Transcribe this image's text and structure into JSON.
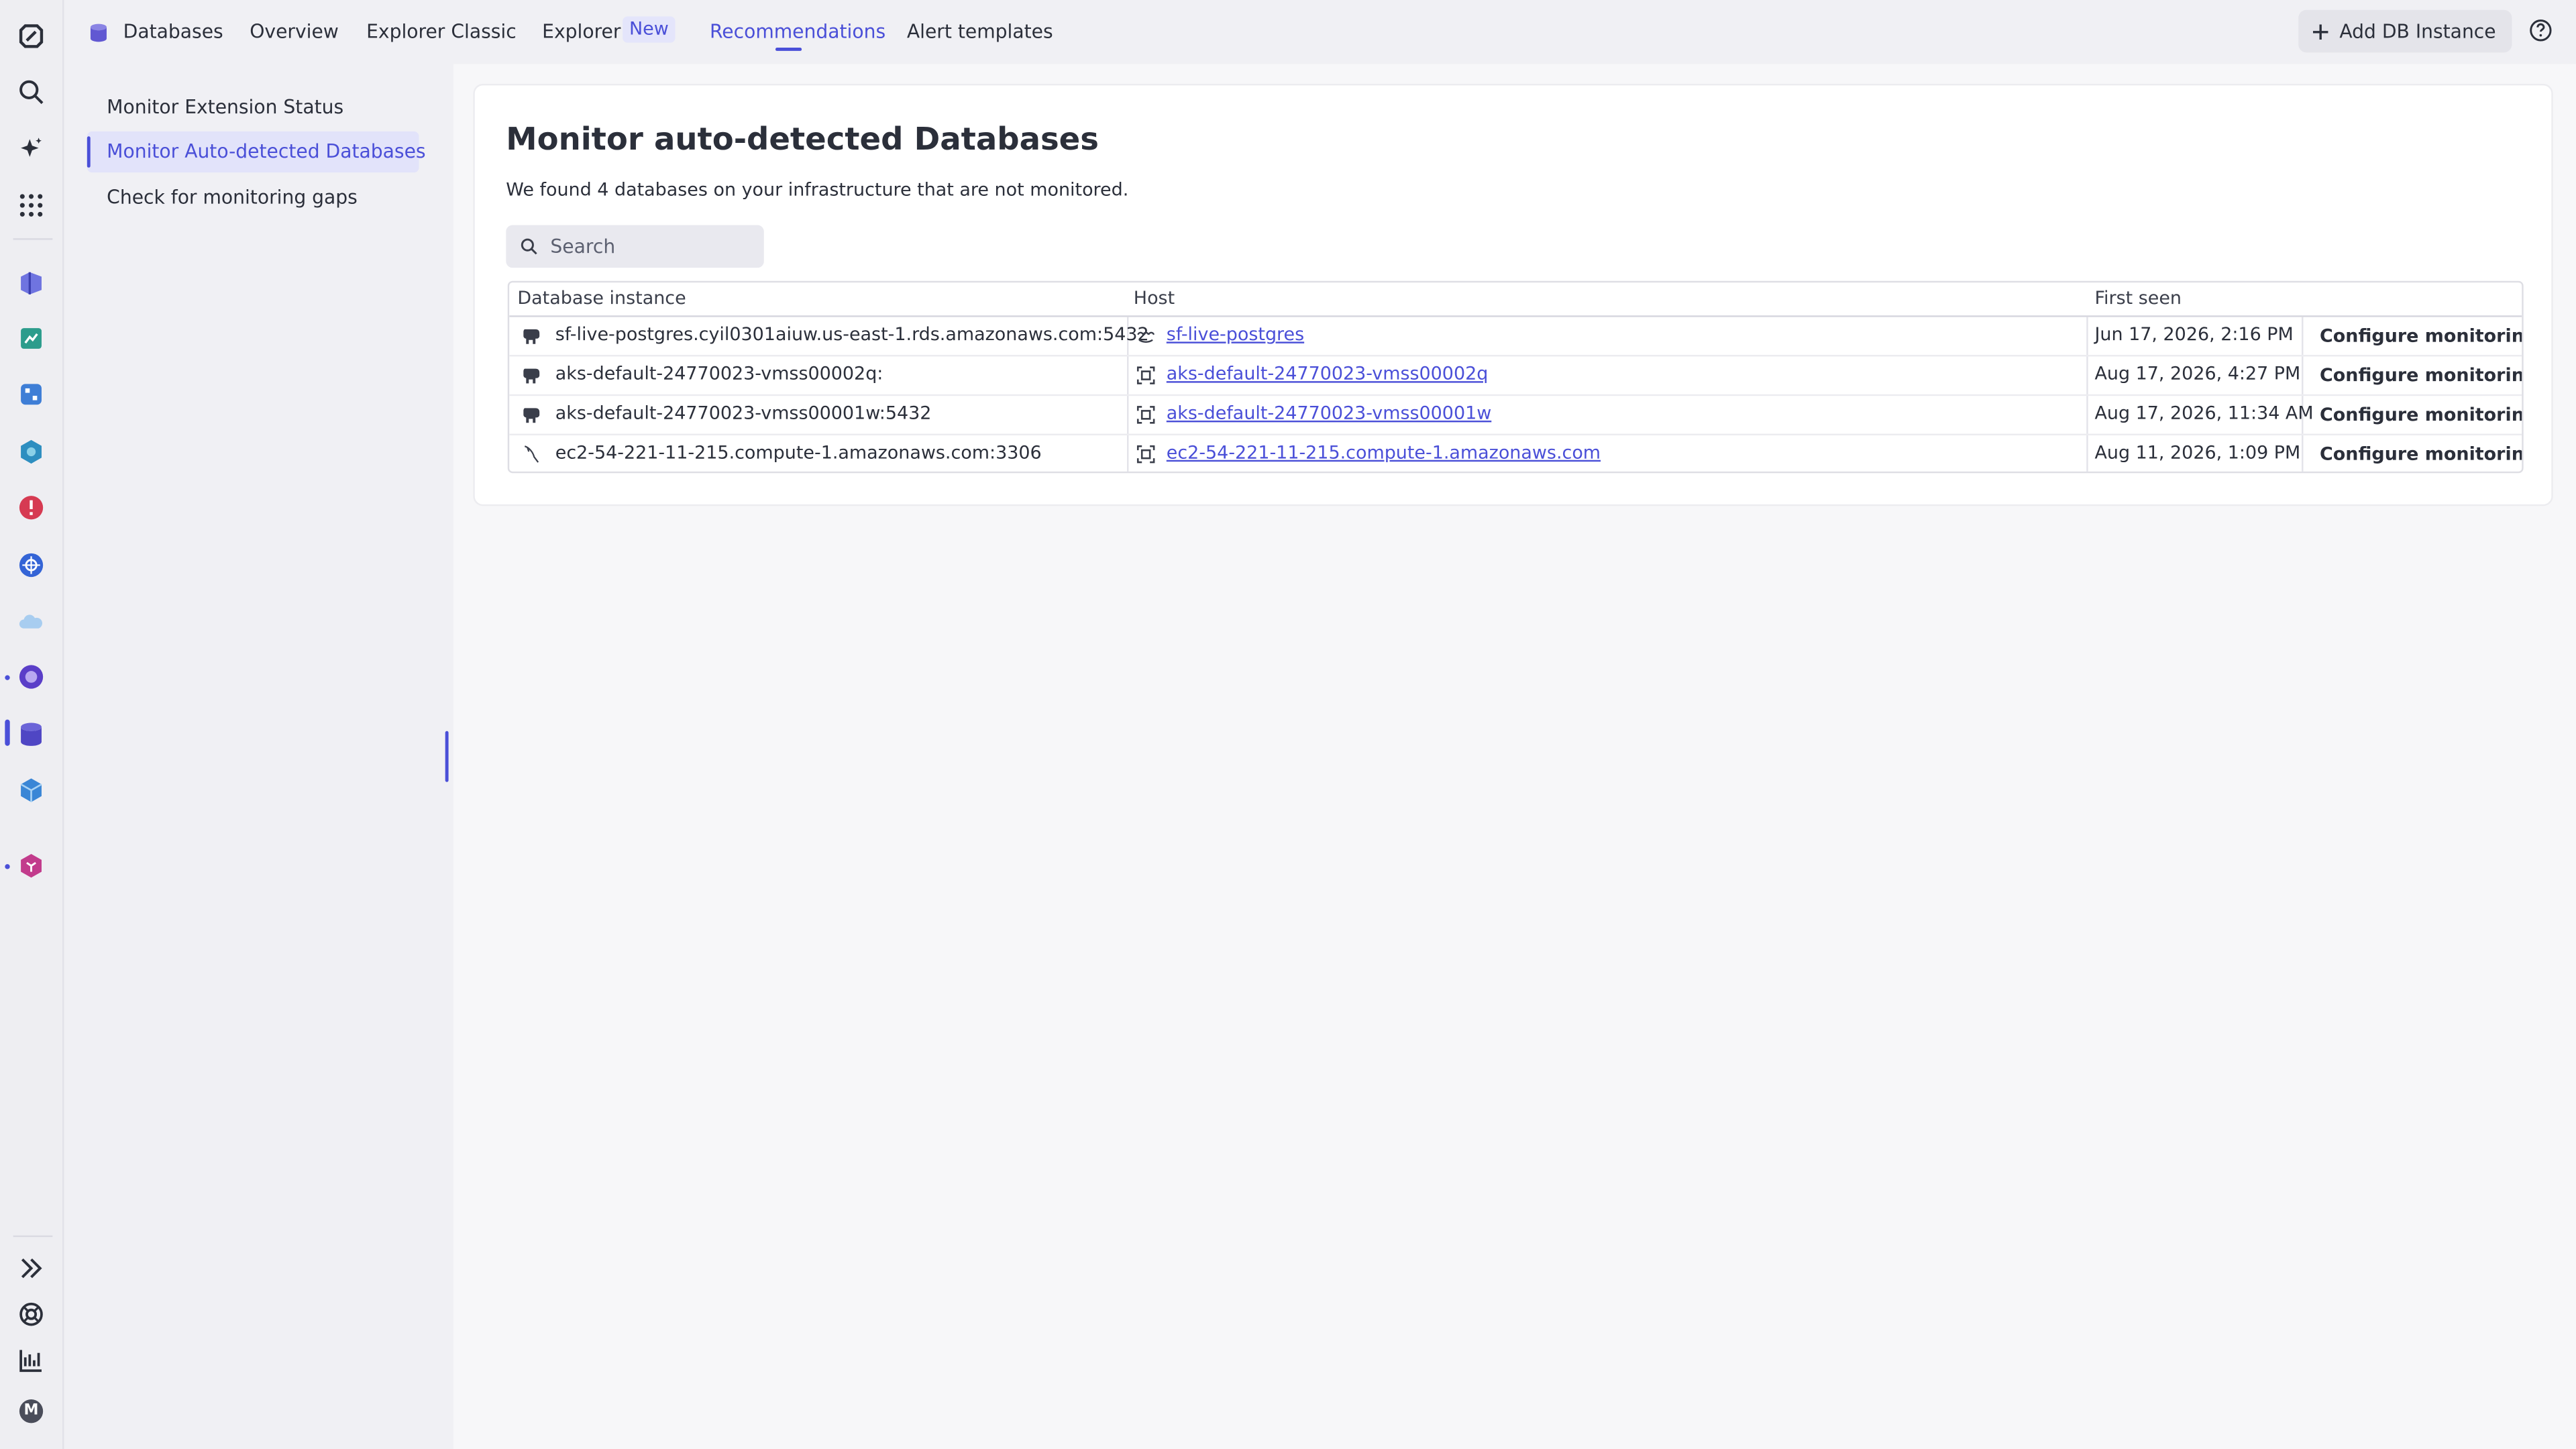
{
  "topbar": {
    "app_name": "Databases",
    "tabs": [
      {
        "label": "Overview"
      },
      {
        "label": "Explorer Classic"
      },
      {
        "label": "Explorer"
      },
      {
        "label": "Recommendations"
      },
      {
        "label": "Alert templates"
      }
    ],
    "explorer_badge": "New",
    "active_tab": "Recommendations",
    "add_button": "Add DB Instance",
    "accent": "#4a4fd8"
  },
  "sidenav": {
    "items": [
      {
        "label": "Monitor Extension Status"
      },
      {
        "label": "Monitor Auto-detected Databases"
      },
      {
        "label": "Check for monitoring gaps"
      }
    ],
    "active_index": 1
  },
  "rail": {
    "user_initial": "M"
  },
  "main": {
    "title": "Monitor auto-detected Databases",
    "subtitle": "We found 4 databases on your infrastructure that are not monitored.",
    "search_placeholder": "Search",
    "columns": [
      "Database instance",
      "Host",
      "First seen",
      ""
    ],
    "rows": [
      {
        "instance": "sf-live-postgres.cyil0301aiuw.us-east-1.rds.amazonaws.com:5432",
        "instance_icon": "postgres-elephant-icon",
        "host": "sf-live-postgres",
        "host_icon": "aws-icon",
        "first_seen": "Jun 17, 2026, 2:16 PM",
        "action": "Configure monitoring"
      },
      {
        "instance": "aks-default-24770023-vmss00002q:",
        "instance_icon": "postgres-elephant-icon",
        "host": "aks-default-24770023-vmss00002q",
        "host_icon": "host-icon",
        "first_seen": "Aug 17, 2026, 4:27 PM",
        "action": "Configure monitoring"
      },
      {
        "instance": "aks-default-24770023-vmss00001w:5432",
        "instance_icon": "postgres-elephant-icon",
        "host": "aks-default-24770023-vmss00001w",
        "host_icon": "host-icon",
        "first_seen": "Aug 17, 2026, 11:34 AM",
        "action": "Configure monitoring"
      },
      {
        "instance": "ec2-54-221-11-215.compute-1.amazonaws.com:3306",
        "instance_icon": "mysql-dolphin-icon",
        "host": "ec2-54-221-11-215.compute-1.amazonaws.com",
        "host_icon": "host-icon",
        "first_seen": "Aug 11, 2026, 1:09 PM",
        "action": "Configure monitoring"
      }
    ]
  }
}
